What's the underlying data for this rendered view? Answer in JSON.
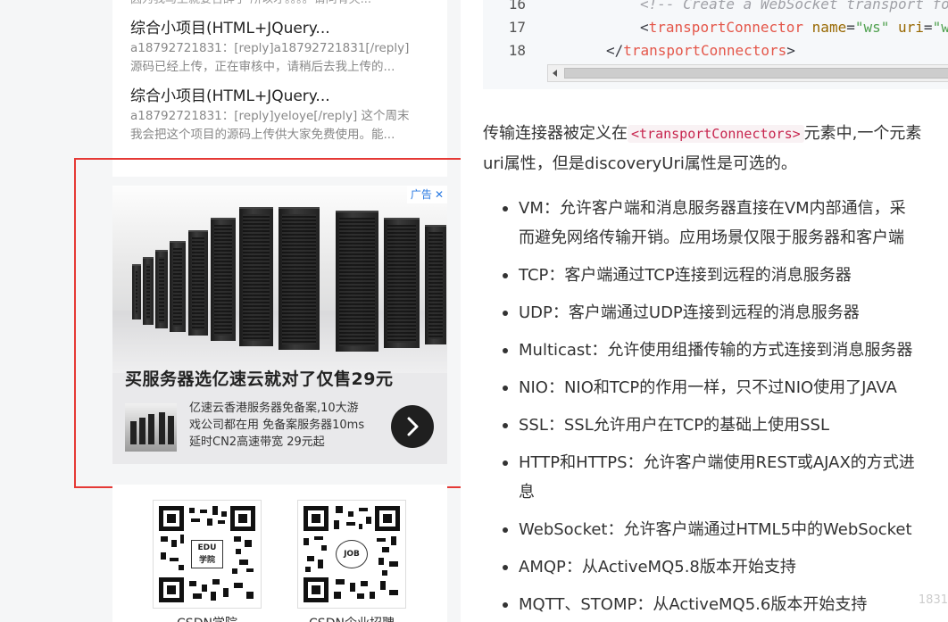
{
  "sidebar": {
    "comments": {
      "cut_line": "因为我马上就要告辞了 所以才。。。。请问有失...",
      "items": [
        {
          "title": "综合小项目(HTML+JQuery...",
          "line1": "a18792721831：[reply]a18792721831[/reply]",
          "line2": "源码已经上传，正在审核中，请稍后去我上传的..."
        },
        {
          "title": "综合小项目(HTML+JQuery...",
          "line1": "a18792721831：[reply]yeloye[/reply] 这个周末",
          "line2": "我会把这个项目的源码上传供大家免费使用。能..."
        }
      ]
    },
    "ad": {
      "badge": "广告",
      "close": "✕",
      "headline": "买服务器选亿速云就对了仅售29元",
      "desc_lines": [
        "亿速云香港服务器免备案,10大游",
        "戏公司都在用 免备案服务器10ms",
        "延时CN2高速带宽 29元起"
      ]
    },
    "qr": [
      {
        "logo_top": "EDU",
        "logo_bottom": "学院",
        "label": "CSDN学院"
      },
      {
        "logo_top": "JOB",
        "logo_bottom": "",
        "label": "CSDN企业招聘"
      }
    ],
    "highlight_color": "#e53935"
  },
  "article": {
    "code": [
      {
        "num": "16",
        "comment": "<!-- Create a WebSocket transport fo"
      },
      {
        "num": "17",
        "open": "<",
        "tag": "transportConnector",
        "attr1": "name",
        "eq1": "=",
        "val1": "\"ws\"",
        "attr2": "uri",
        "eq2": "=",
        "val2": "\"w"
      },
      {
        "num": "18",
        "close_open": "</",
        "tag": "transportConnectors",
        "close_end": ">"
      }
    ],
    "paragraph": {
      "before": "传输连接器被定义在",
      "code": "<transportConnectors>",
      "after": "元素中,一个元素",
      "line2": "uri属性，但是discoveryUri属性是可选的。"
    },
    "bullets": [
      "VM：允许客户端和消息服务器直接在VM内部通信，采",
      "而避免网络传输开销。应用场景仅限于服务器和客户端",
      "TCP：客户端通过TCP连接到远程的消息服务器",
      "UDP：客户端通过UDP连接到远程的消息服务器",
      "Multicast：允许使用组播传输的方式连接到消息服务器",
      "NIO：NIO和TCP的作用一样，只不过NIO使用了JAVA",
      "SSL：SSL允许用户在TCP的基础上使用SSL",
      "HTTP和HTTPS：允许客户端使用REST或AJAX的方式进",
      "息",
      "WebSocket：允许客户端通过HTML5中的WebSocket",
      "AMQP：从ActiveMQ5.8版本开始支持",
      "MQTT、STOMP：从ActiveMQ5.6版本开始支持"
    ],
    "watermark": "1831"
  }
}
